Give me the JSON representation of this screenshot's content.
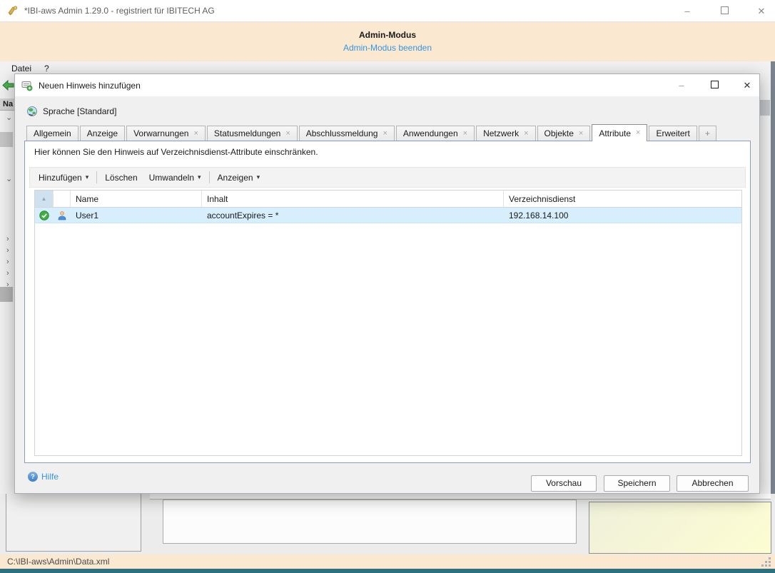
{
  "window": {
    "title": "*IBI-aws Admin 1.29.0 - registriert für IBITECH AG",
    "admin_header": {
      "title": "Admin-Modus",
      "link": "Admin-Modus beenden"
    },
    "menu": [
      "Datei",
      "?"
    ],
    "tree_header": "Na",
    "status_path": "C:\\IBI-aws\\Admin\\Data.xml"
  },
  "dialog": {
    "title": "Neuen Hinweis hinzufügen",
    "language_label": "Sprache [Standard]",
    "description": "Hier können Sie den Hinweis auf Verzeichnisdienst-Attribute einschränken.",
    "tabs": [
      {
        "label": "Allgemein",
        "closable": false,
        "active": false
      },
      {
        "label": "Anzeige",
        "closable": false,
        "active": false
      },
      {
        "label": "Vorwarnungen",
        "closable": true,
        "active": false
      },
      {
        "label": "Statusmeldungen",
        "closable": true,
        "active": false
      },
      {
        "label": "Abschlussmeldung",
        "closable": true,
        "active": false
      },
      {
        "label": "Anwendungen",
        "closable": true,
        "active": false
      },
      {
        "label": "Netzwerk",
        "closable": true,
        "active": false
      },
      {
        "label": "Objekte",
        "closable": true,
        "active": false
      },
      {
        "label": "Attribute",
        "closable": true,
        "active": true
      },
      {
        "label": "Erweitert",
        "closable": false,
        "active": false
      },
      {
        "label": "+",
        "closable": false,
        "active": false
      }
    ],
    "toolbar": {
      "add": "Hinzufügen",
      "delete": "Löschen",
      "convert": "Umwandeln",
      "show": "Anzeigen"
    },
    "table": {
      "columns": [
        "Name",
        "Inhalt",
        "Verzeichnisdienst"
      ],
      "rows": [
        {
          "name": "User1",
          "content": "accountExpires = *",
          "directory": "192.168.14.100"
        }
      ]
    },
    "footer": {
      "help": "Hilfe",
      "preview": "Vorschau",
      "save": "Speichern",
      "cancel": "Abbrechen"
    }
  },
  "icons": {
    "close_tab": "×",
    "dropdown": "▾",
    "sort_asc": "▲",
    "chevron_down": "⌄",
    "chevron_right": "›",
    "minimize": "–",
    "close": "✕",
    "help": "?",
    "check": "✓"
  },
  "colors": {
    "header_bg": "#fae8d0",
    "link_blue": "#3795e0",
    "row_selection": "#d7effc",
    "bottom_strip": "#2d7080",
    "panel_border": "#849ebc"
  }
}
